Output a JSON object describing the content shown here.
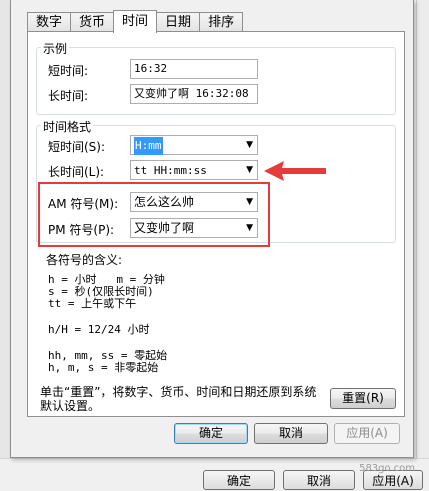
{
  "tabs": [
    "数字",
    "货币",
    "时间",
    "日期",
    "排序"
  ],
  "example": {
    "title": "示例",
    "short_label": "短时间:",
    "short_value": "16:32",
    "long_label": "长时间:",
    "long_value": "又变帅了啊 16:32:08"
  },
  "format": {
    "title": "时间格式",
    "short_label": "短时间(S):",
    "short_value": "H:mm",
    "long_label": "长时间(L):",
    "long_value": "tt HH:mm:ss",
    "am_label": "AM 符号(M):",
    "am_value": "怎么这么帅",
    "pm_label": "PM 符号(P):",
    "pm_value": "又变帅了啊"
  },
  "meaning": {
    "title": "各符号的含义:",
    "line1": "h = 小时   m = 分钟",
    "line2": "s = 秒(仅限长时间)",
    "line3": "tt = 上午或下午",
    "line4": "h/H = 12/24 小时",
    "line5": "hh, mm, ss = 零起始",
    "line6": "h, m, s = 非零起始"
  },
  "reset_text": "单击“重置”，将数字、货币、时间和日期还原到系统默认设置。",
  "buttons": {
    "reset": "重置(R)",
    "ok": "确定",
    "cancel": "取消",
    "apply": "应用(A)"
  },
  "bg_buttons": {
    "ok": "确定",
    "cancel": "取消",
    "apply": "应用(A)"
  },
  "watermark": "583go.com",
  "colors": {
    "highlight": "#e53b3b",
    "selection": "#3399ff"
  }
}
